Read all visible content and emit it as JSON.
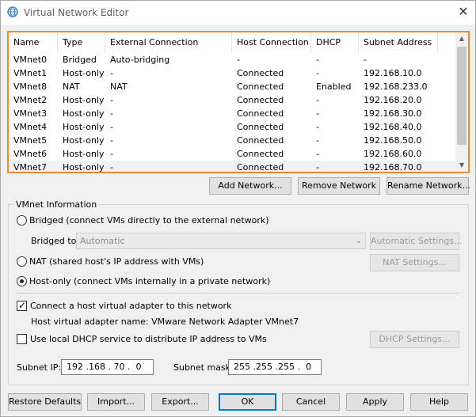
{
  "window": {
    "title": "Virtual Network Editor",
    "close_glyph": "✕"
  },
  "network_table": {
    "columns": [
      "Name",
      "Type",
      "External Connection",
      "Host Connection",
      "DHCP",
      "Subnet Address"
    ],
    "rows": [
      {
        "name": "VMnet0",
        "type": "Bridged",
        "external": "Auto-bridging",
        "host": "-",
        "dhcp": "-",
        "subnet": "-"
      },
      {
        "name": "VMnet1",
        "type": "Host-only",
        "external": "-",
        "host": "Connected",
        "dhcp": "-",
        "subnet": "192.168.10.0"
      },
      {
        "name": "VMnet8",
        "type": "NAT",
        "external": "NAT",
        "host": "Connected",
        "dhcp": "Enabled",
        "subnet": "192.168.233.0"
      },
      {
        "name": "VMnet2",
        "type": "Host-only",
        "external": "-",
        "host": "Connected",
        "dhcp": "-",
        "subnet": "192.168.20.0"
      },
      {
        "name": "VMnet3",
        "type": "Host-only",
        "external": "-",
        "host": "Connected",
        "dhcp": "-",
        "subnet": "192.168.30.0"
      },
      {
        "name": "VMnet4",
        "type": "Host-only",
        "external": "-",
        "host": "Connected",
        "dhcp": "-",
        "subnet": "192.168.40.0"
      },
      {
        "name": "VMnet5",
        "type": "Host-only",
        "external": "-",
        "host": "Connected",
        "dhcp": "-",
        "subnet": "192.168.50.0"
      },
      {
        "name": "VMnet6",
        "type": "Host-only",
        "external": "-",
        "host": "Connected",
        "dhcp": "-",
        "subnet": "192.168.60.0"
      },
      {
        "name": "VMnet7",
        "type": "Host-only",
        "external": "-",
        "host": "Connected",
        "dhcp": "-",
        "subnet": "192.168.70.0"
      }
    ],
    "selected_row": "VMnet7"
  },
  "table_buttons": {
    "add": "Add Network...",
    "remove": "Remove Network",
    "rename": "Rename Network..."
  },
  "vmnet_info": {
    "legend": "VMnet Information",
    "bridged_label": "Bridged (connect VMs directly to the external network)",
    "bridged_to_label": "Bridged to:",
    "bridged_to_value": "Automatic",
    "automatic_settings": "Automatic Settings...",
    "nat_label": "NAT (shared host's IP address with VMs)",
    "nat_settings": "NAT Settings...",
    "hostonly_label": "Host-only (connect VMs internally in a private network)",
    "selected_mode": "host-only",
    "connect_adapter_label": "Connect a host virtual adapter to this network",
    "connect_adapter_checked": true,
    "adapter_name_text": "Host virtual adapter name: VMware Network Adapter VMnet7",
    "dhcp_label": "Use local DHCP service to distribute IP address to VMs",
    "dhcp_checked": false,
    "dhcp_settings": "DHCP Settings...",
    "subnet_ip_label": "Subnet IP:",
    "subnet_ip_value": "192 .168 . 70 .  0",
    "subnet_mask_label": "Subnet mask:",
    "subnet_mask_value": "255 .255 .255 .  0"
  },
  "footer_buttons": {
    "restore": "Restore Defaults",
    "import": "Import...",
    "export": "Export...",
    "ok": "OK",
    "cancel": "Cancel",
    "apply": "Apply",
    "help": "Help"
  },
  "colors": {
    "highlight_border": "#f08a24",
    "ok_border": "#0078d7",
    "title_icon": "#2e7fd0"
  }
}
